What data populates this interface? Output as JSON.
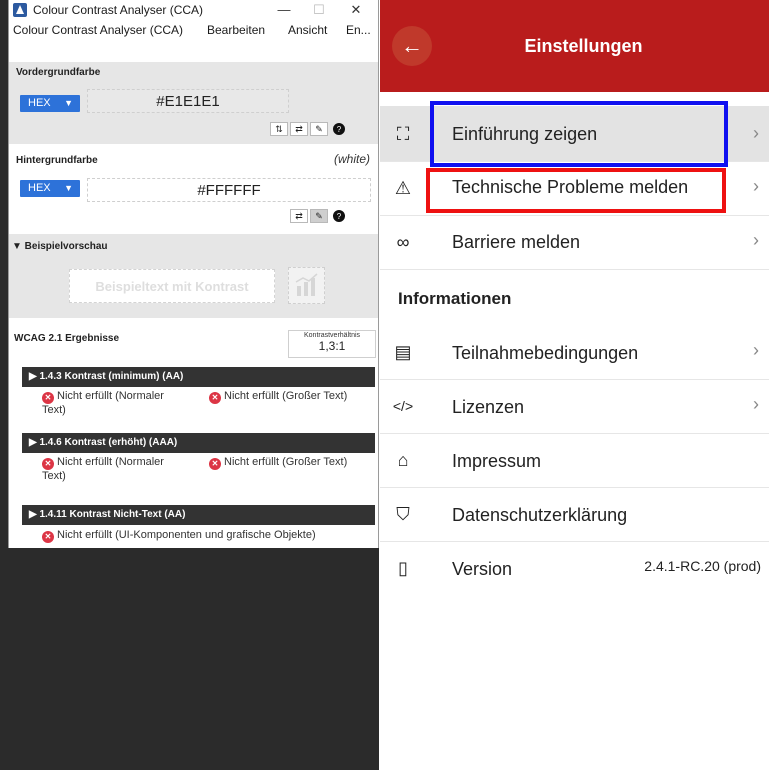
{
  "cca": {
    "window_title": "Colour Contrast Analyser (CCA)",
    "window_buttons": {
      "minimize": "—",
      "maximize": "☐",
      "close": "✕"
    },
    "menu": [
      "Colour Contrast Analyser (CCA)",
      "Bearbeiten",
      "Ansicht",
      "En..."
    ],
    "foreground": {
      "label": "Vordergrundfarbe",
      "format": "HEX",
      "value": "#E1E1E1",
      "tools": [
        "⇅",
        "⇄",
        "✎",
        "?"
      ]
    },
    "background": {
      "label": "Hintergrundfarbe",
      "note": "(white)",
      "format": "HEX",
      "value": "#FFFFFF",
      "tools": [
        "⇄",
        "✎",
        "?"
      ]
    },
    "preview": {
      "label": "▼ Beispielvorschau",
      "sample_text": "Beispieltext mit Kontrast"
    },
    "results": {
      "label": "WCAG 2.1 Ergebnisse",
      "ratio_label": "Kontrastverhältnis",
      "ratio_value": "1,3:1",
      "criteria": [
        {
          "title": "▶ 1.4.3 Kontrast (minimum) (AA)",
          "left": "Nicht erfüllt (Normaler Text)",
          "right": "Nicht erfüllt (Großer Text)"
        },
        {
          "title": "▶ 1.4.6 Kontrast (erhöht) (AAA)",
          "left": "Nicht erfüllt (Normaler Text)",
          "right": "Nicht erfüllt (Großer Text)"
        },
        {
          "title": "▶ 1.4.11 Kontrast Nicht-Text (AA)",
          "left": "Nicht erfüllt (UI-Komponenten und grafische Objekte)"
        }
      ]
    },
    "colors": {
      "accent": "#2d72d9",
      "fail": "#dc3545",
      "criterion_bar": "#333333"
    }
  },
  "app": {
    "title": "Einstellungen",
    "back_icon": "arrow-left-icon",
    "items": [
      {
        "icon": "presentation-icon",
        "glyph": "⛶",
        "label": "Einführung zeigen",
        "chevron": "›"
      },
      {
        "icon": "warning-icon",
        "glyph": "⚠",
        "label": "Technische Probleme melden",
        "chevron": "›"
      },
      {
        "icon": "glasses-icon",
        "glyph": "∞",
        "label": "Barriere melden",
        "chevron": "›"
      }
    ],
    "info_header": "Informationen",
    "info_items": [
      {
        "icon": "book-icon",
        "glyph": "▤",
        "label": "Teilnahmebedingungen",
        "chevron": "›"
      },
      {
        "icon": "code-icon",
        "glyph": "</>",
        "label": "Lizenzen",
        "chevron": "›"
      },
      {
        "icon": "bank-icon",
        "glyph": "⌂",
        "label": "Impressum"
      },
      {
        "icon": "shield-icon",
        "glyph": "⛉",
        "label": "Datenschutzerklärung"
      },
      {
        "icon": "phone-icon",
        "glyph": "▯",
        "label": "Version",
        "meta": "2.4.1-RC.20 (prod)"
      }
    ],
    "colors": {
      "header": "#b91c1c",
      "highlight_blue": "#1010f0",
      "highlight_red": "#ee1111"
    }
  }
}
